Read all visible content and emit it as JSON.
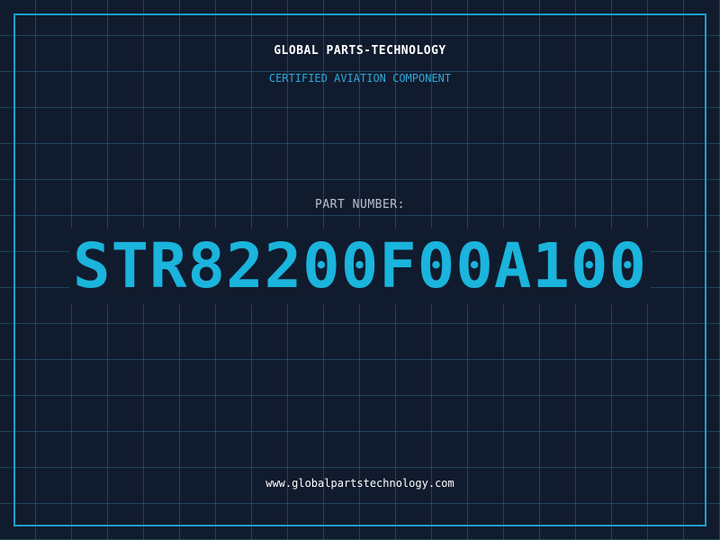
{
  "header": {
    "company_name": "GLOBAL PARTS-TECHNOLOGY",
    "tagline": "CERTIFIED AVIATION COMPONENT"
  },
  "part": {
    "label": "PART NUMBER:",
    "number": "STR82200F00A100"
  },
  "footer": {
    "website": "www.globalpartstechnology.com"
  },
  "colors": {
    "background": "#111b2e",
    "grid": "#28789a",
    "accent": "#1ab4dc",
    "frame": "#1a9fc8"
  }
}
